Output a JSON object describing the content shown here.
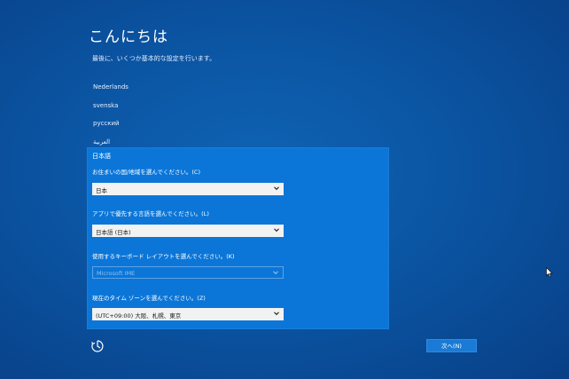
{
  "header": {
    "title": "こんにちは",
    "subtitle": "最後に、いくつか基本的な設定を行います。"
  },
  "languages": [
    "Nederlands",
    "svenska",
    "русский",
    "العربية"
  ],
  "panel": {
    "selected_language": "日本語",
    "country_label": "お住まいの国/地域を選んでください。(C)",
    "country_value": "日本",
    "app_language_label": "アプリで優先する言語を選んでください。(L)",
    "app_language_value": "日本語 (日本)",
    "keyboard_label": "使用するキーボード レイアウトを選んでください。(K)",
    "keyboard_value": "Microsoft IME",
    "timezone_label": "現在のタイム ゾーンを選んでください。(Z)",
    "timezone_value": "(UTC+09:00) 大阪、札幌、東京"
  },
  "footer": {
    "next_label": "次へ(N)",
    "ease_of_access_icon": "ease-of-access-icon"
  },
  "colors": {
    "background": "#0b55a3",
    "panel": "#0b76d8",
    "dropdown": "#f2f2f2",
    "button": "#1a7bd6"
  }
}
